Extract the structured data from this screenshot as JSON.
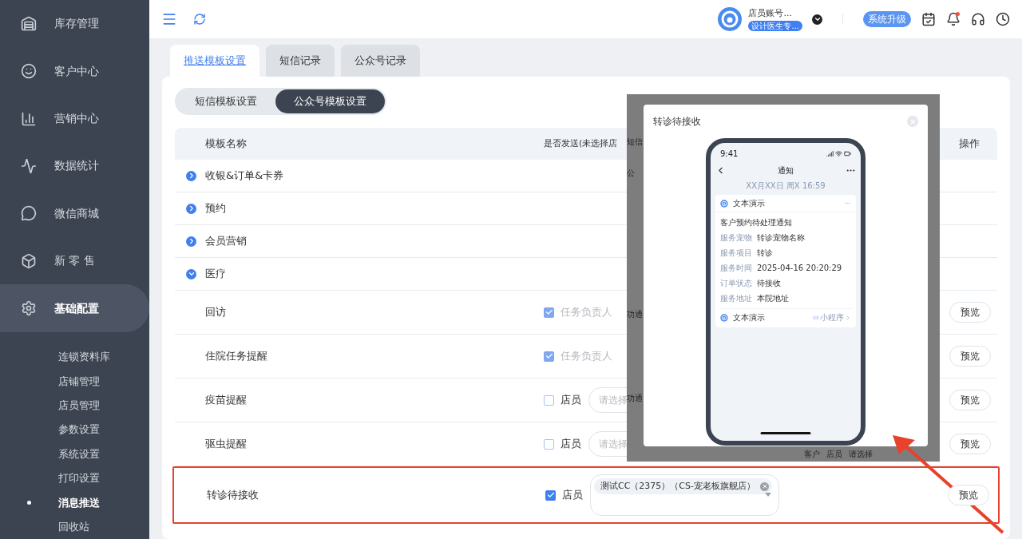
{
  "sidebar": {
    "items": [
      {
        "label": "库存管理",
        "selected": false
      },
      {
        "label": "客户中心",
        "selected": false
      },
      {
        "label": "营销中心",
        "selected": false
      },
      {
        "label": "数据统计",
        "selected": false
      },
      {
        "label": "微信商城",
        "selected": false
      },
      {
        "label": "新 零 售",
        "selected": false
      },
      {
        "label": "基础配置",
        "selected": true
      }
    ],
    "submenu": [
      {
        "label": "连锁资料库",
        "selected": false
      },
      {
        "label": "店铺管理",
        "selected": false
      },
      {
        "label": "店员管理",
        "selected": false
      },
      {
        "label": "参数设置",
        "selected": false
      },
      {
        "label": "系统设置",
        "selected": false
      },
      {
        "label": "打印设置",
        "selected": false
      },
      {
        "label": "消息推送",
        "selected": true
      },
      {
        "label": "回收站",
        "selected": false
      }
    ]
  },
  "header": {
    "account": "店员账号...",
    "role_badge": "设计医生专...",
    "upgrade": "系统升级",
    "has_unread": true
  },
  "tabs": [
    {
      "label": "推送模板设置",
      "selected": true
    },
    {
      "label": "短信记录",
      "selected": false
    },
    {
      "label": "公众号记录",
      "selected": false
    }
  ],
  "segments": [
    {
      "label": "短信模板设置",
      "selected": false
    },
    {
      "label": "公众号模板设置",
      "selected": true
    }
  ],
  "table": {
    "columns": [
      "模板名称",
      "是否发送(未选择店",
      "操作"
    ],
    "groups": [
      {
        "label": "收银&订单&卡券",
        "expanded": false
      },
      {
        "label": "预约",
        "expanded": false
      },
      {
        "label": "会员营销",
        "expanded": false
      },
      {
        "label": "医疗",
        "expanded": true
      }
    ],
    "rows": [
      {
        "name": "回访",
        "checked": true,
        "disabled": true,
        "recipient": "任务负责人",
        "preview": "预览",
        "highlighted": false
      },
      {
        "name": "住院任务提醒",
        "checked": true,
        "disabled": true,
        "recipient": "任务负责人",
        "preview": "预览",
        "highlighted": false
      },
      {
        "name": "疫苗提醒",
        "checked": false,
        "recipient": "店员",
        "placeholder": "请选择",
        "preview": "预览",
        "highlighted": false
      },
      {
        "name": "驱虫提醒",
        "checked": false,
        "recipient": "店员",
        "placeholder": "请选择",
        "preview": "预览",
        "highlighted": false
      },
      {
        "name": "转诊待接收",
        "checked": true,
        "recipient": "店员",
        "tags": [
          "测试CC（2375）（CS-宠老板旗舰店）"
        ],
        "preview": "预览",
        "highlighted": true
      }
    ]
  },
  "backdrop_fragments": [
    "短信",
    "公",
    "功通",
    "功通"
  ],
  "backdrop_bottom": [
    "客户",
    "店员",
    "请选择"
  ],
  "dialog": {
    "title": "转诊待接收",
    "phone": {
      "time": "9:41",
      "nav_title": "通知",
      "date": "XX月XX日 周X 16:59",
      "sender": "文本演示",
      "message_title": "客户预约待处理通知",
      "fields": [
        {
          "label": "服务宠物",
          "value": "转诊宠物名称"
        },
        {
          "label": "服务项目",
          "value": "转诊"
        },
        {
          "label": "服务时间",
          "value": "2025-04-16 20:20:29"
        },
        {
          "label": "订单状态",
          "value": "待接收"
        },
        {
          "label": "服务地址",
          "value": "本院地址"
        }
      ],
      "footer_sender": "文本演示",
      "footer_link": "小程序"
    }
  }
}
